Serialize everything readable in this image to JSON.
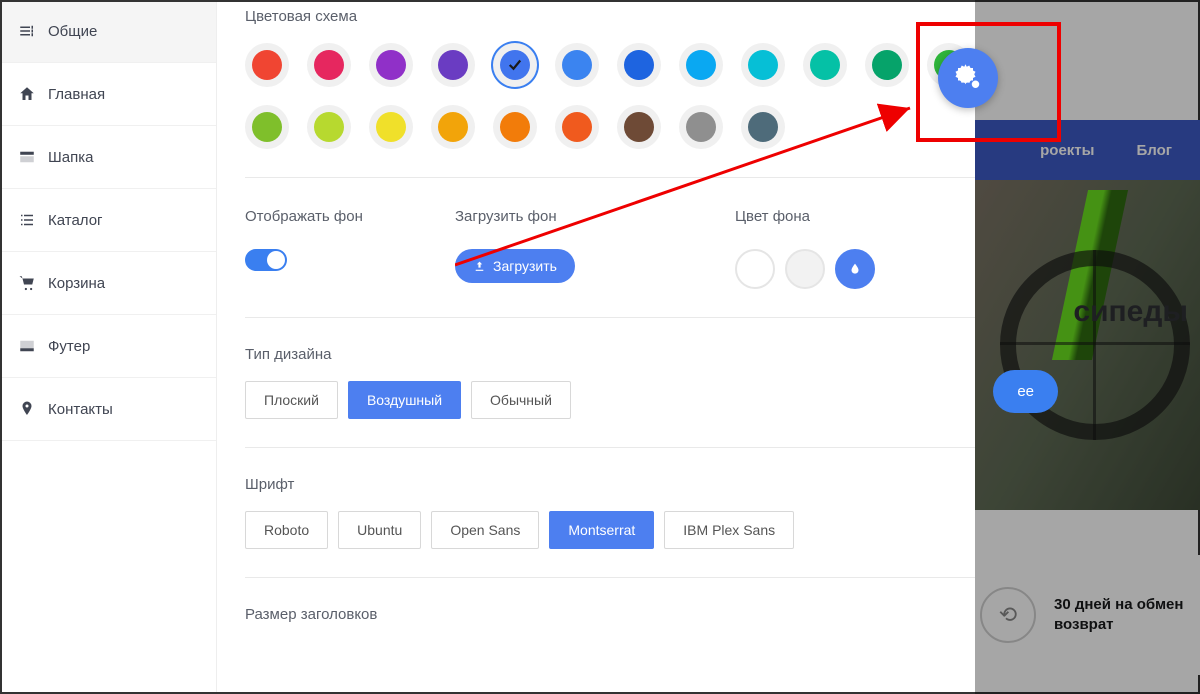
{
  "sidebar": {
    "items": [
      {
        "label": "Общие",
        "icon": "sliders"
      },
      {
        "label": "Главная",
        "icon": "home"
      },
      {
        "label": "Шапка",
        "icon": "window"
      },
      {
        "label": "Каталог",
        "icon": "list"
      },
      {
        "label": "Корзина",
        "icon": "cart"
      },
      {
        "label": "Футер",
        "icon": "footer"
      },
      {
        "label": "Контакты",
        "icon": "map-pin"
      }
    ]
  },
  "color_scheme": {
    "label": "Цветовая схема",
    "row1": [
      "#f04532",
      "#e6275f",
      "#9030c8",
      "#6a3cc2",
      "#4175ee",
      "#3b84f0",
      "#1e64e0",
      "#0aa8f2",
      "#06bfd6",
      "#05c1a6",
      "#06a36a",
      "#2fb53b"
    ],
    "row2": [
      "#7fbf2b",
      "#b7d92f",
      "#f0e02a",
      "#f2a40a",
      "#f27c0a",
      "#f05a1e",
      "#6e4a36",
      "#8f8f8f",
      "#4e6b7a"
    ],
    "selected_index": 4
  },
  "background": {
    "show_label": "Отображать фон",
    "show": true,
    "upload_label": "Загрузить фон",
    "upload_btn": "Загрузить",
    "color_label": "Цвет фона",
    "colors": [
      "#ffffff",
      "#f2f2f2",
      "custom"
    ],
    "selected": 2
  },
  "design_type": {
    "label": "Тип дизайна",
    "options": [
      "Плоский",
      "Воздушный",
      "Обычный"
    ],
    "selected": 1
  },
  "font": {
    "label": "Шрифт",
    "options": [
      "Roboto",
      "Ubuntu",
      "Open Sans",
      "Montserrat",
      "IBM Plex Sans"
    ],
    "selected": 3
  },
  "heading_size": {
    "label": "Размер заголовков"
  },
  "preview": {
    "nav": [
      "роекты",
      "Блог"
    ],
    "hero_title": "сипеды",
    "hero_btn": "ее",
    "feature": "30 дней на обмен возврат"
  }
}
